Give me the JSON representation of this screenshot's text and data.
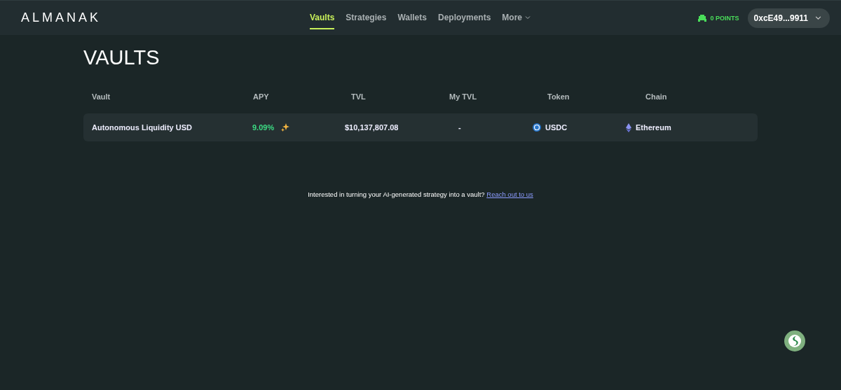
{
  "brand": "ALMANAK",
  "nav": [
    {
      "label": "Vaults",
      "selected": true
    },
    {
      "label": "Strategies",
      "selected": false
    },
    {
      "label": "Wallets",
      "selected": false
    },
    {
      "label": "Deployments",
      "selected": false
    },
    {
      "label": "More",
      "selected": false,
      "dropdown": true
    }
  ],
  "points": "0 POINTS",
  "wallet": "0xcE49...9911",
  "page_title": "VAULTS",
  "table": {
    "columns": [
      "Vault",
      "APY",
      "TVL",
      "My TVL",
      "Token",
      "Chain"
    ],
    "rows": [
      {
        "vault": "Autonomous Liquidity USD",
        "apy": "9.09%",
        "tvl": "$10,137,807.08",
        "my_tvl": "-",
        "token": "USDC",
        "chain": "Ethereum"
      }
    ]
  },
  "footer_note": {
    "text": "Interested in turning your AI-generated strategy into a vault?",
    "link": "Reach out to us"
  }
}
